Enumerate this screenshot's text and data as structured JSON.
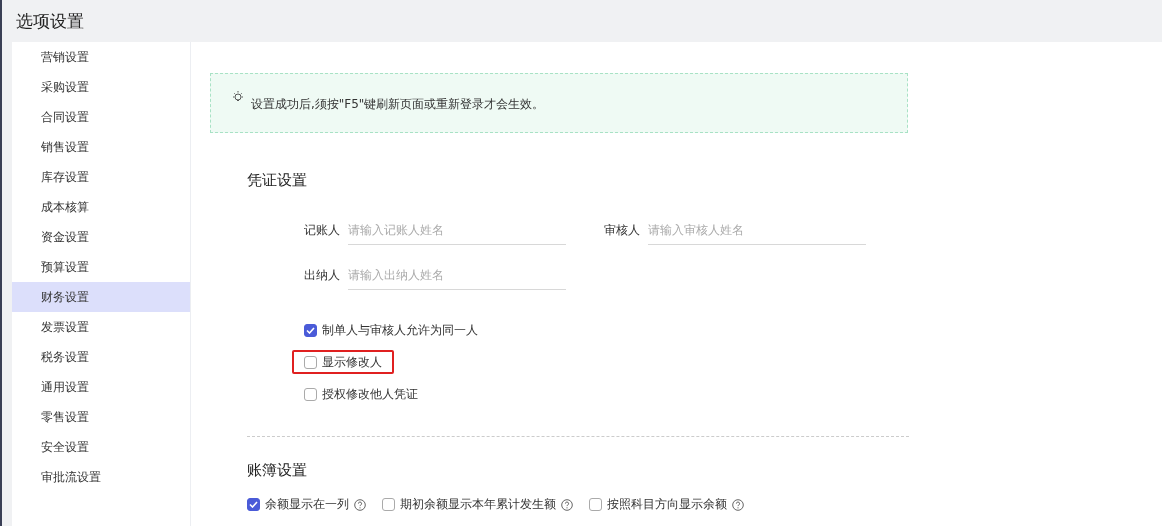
{
  "window": {
    "title": "选项设置"
  },
  "sidebar": {
    "items": [
      {
        "label": "营销设置",
        "selected": false
      },
      {
        "label": "采购设置",
        "selected": false
      },
      {
        "label": "合同设置",
        "selected": false
      },
      {
        "label": "销售设置",
        "selected": false
      },
      {
        "label": "库存设置",
        "selected": false
      },
      {
        "label": "成本核算",
        "selected": false
      },
      {
        "label": "资金设置",
        "selected": false
      },
      {
        "label": "预算设置",
        "selected": false
      },
      {
        "label": "财务设置",
        "selected": true
      },
      {
        "label": "发票设置",
        "selected": false
      },
      {
        "label": "税务设置",
        "selected": false
      },
      {
        "label": "通用设置",
        "selected": false
      },
      {
        "label": "零售设置",
        "selected": false
      },
      {
        "label": "安全设置",
        "selected": false
      },
      {
        "label": "审批流设置",
        "selected": false
      }
    ]
  },
  "notice": {
    "text": "设置成功后,须按\"F5\"键刷新页面或重新登录才会生效。"
  },
  "voucher_section": {
    "title": "凭证设置",
    "fields": [
      {
        "label": "记账人",
        "placeholder": "请输入记账人姓名"
      },
      {
        "label": "审核人",
        "placeholder": "请输入审核人姓名"
      },
      {
        "label": "出纳人",
        "placeholder": "请输入出纳人姓名"
      }
    ],
    "options": [
      {
        "label": "制单人与审核人允许为同一人",
        "checked": true,
        "highlighted": false
      },
      {
        "label": "显示修改人",
        "checked": false,
        "highlighted": true
      },
      {
        "label": "授权修改他人凭证",
        "checked": false,
        "highlighted": false
      }
    ]
  },
  "ledger_section": {
    "title": "账簿设置",
    "options": [
      {
        "label": "余额显示在一列",
        "checked": true,
        "help": true
      },
      {
        "label": "期初余额显示本年累计发生额",
        "checked": false,
        "help": true
      },
      {
        "label": "按照科目方向显示余额",
        "checked": false,
        "help": true
      }
    ]
  }
}
